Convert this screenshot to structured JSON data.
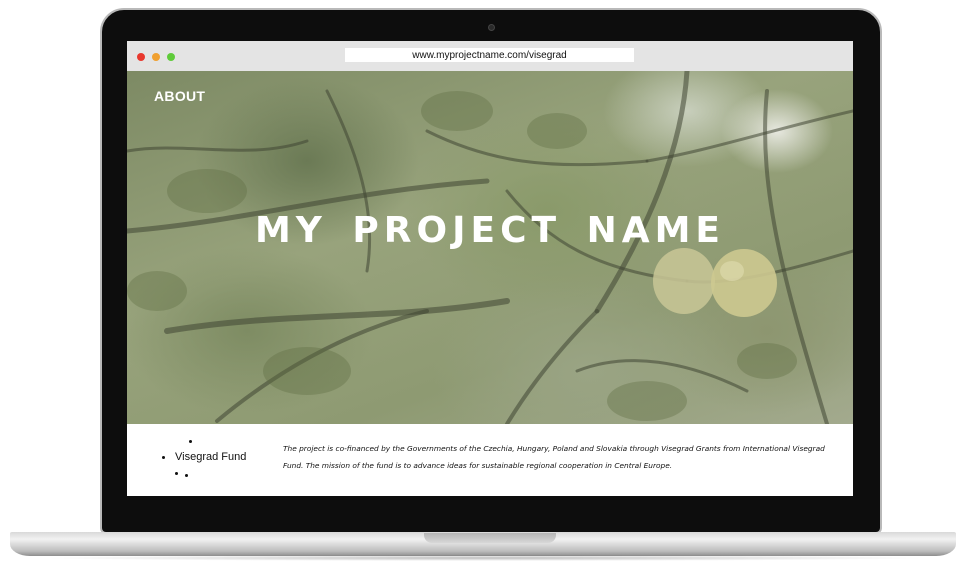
{
  "browser": {
    "url": "www.myprojectname.com/visegrad"
  },
  "hero": {
    "nav_about": "ABOUT",
    "title": "MY PROJECT NAME"
  },
  "footer": {
    "fund_label": "Visegrad Fund",
    "description": "The project is co-financed by the Governments of the Czechia, Hungary, Poland and Slovakia through Visegrad Grants from International Visegrad Fund. The mission of the fund is to advance ideas for sustainable regional cooperation in Central Europe."
  },
  "colors": {
    "close": "#e8382e",
    "minimize": "#f0a030",
    "maximize": "#5fcb3a"
  }
}
